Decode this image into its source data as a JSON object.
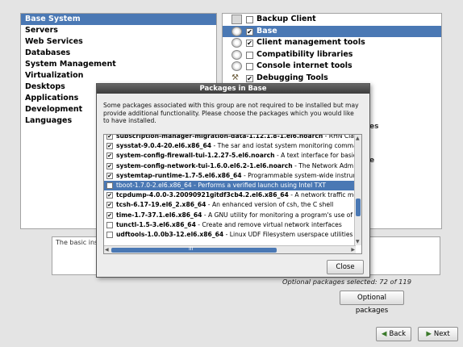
{
  "categories": [
    {
      "label": "Base System",
      "selected": true
    },
    {
      "label": "Servers",
      "selected": false
    },
    {
      "label": "Web Services",
      "selected": false
    },
    {
      "label": "Databases",
      "selected": false
    },
    {
      "label": "System Management",
      "selected": false
    },
    {
      "label": "Virtualization",
      "selected": false
    },
    {
      "label": "Desktops",
      "selected": false
    },
    {
      "label": "Applications",
      "selected": false
    },
    {
      "label": "Development",
      "selected": false
    },
    {
      "label": "Languages",
      "selected": false
    }
  ],
  "groups": [
    {
      "label": "Backup Client",
      "checked": false,
      "selected": false,
      "icon": "panel-icon"
    },
    {
      "label": "Base",
      "checked": true,
      "selected": true,
      "icon": "disk-icon"
    },
    {
      "label": "Client management tools",
      "checked": true,
      "selected": false,
      "icon": "disk-icon"
    },
    {
      "label": "Compatibility libraries",
      "checked": false,
      "selected": false,
      "icon": "disk-icon"
    },
    {
      "label": "Console internet tools",
      "checked": false,
      "selected": false,
      "icon": "disk-icon"
    },
    {
      "label": "Debugging Tools",
      "checked": true,
      "selected": false,
      "icon": "tools-icon"
    }
  ],
  "group_overflow_glyphs": [
    "es",
    "e"
  ],
  "description": "The basic inst",
  "optional_selected": "Optional packages selected: 72 of 119",
  "buttons": {
    "optional_packages": "Optional packages",
    "back": "Back",
    "next": "Next",
    "close": "Close"
  },
  "dialog": {
    "title": "Packages in Base",
    "intro": "Some packages associated with this group are not required to be installed but may provide additional functionality. Please choose the packages which you would like to have installed.",
    "packages": [
      {
        "name": "subscription-manager-migration-data-1.12.1.8-1.el6.noarch",
        "desc": " - RHN Cla",
        "checked": true,
        "selected": false
      },
      {
        "name": "sysstat-9.0.4-20.el6.x86_64",
        "desc": " - The sar and iostat system monitoring comman",
        "checked": true,
        "selected": false
      },
      {
        "name": "system-config-firewall-tui-1.2.27-5.el6.noarch",
        "desc": " - A text interface for basic",
        "checked": true,
        "selected": false
      },
      {
        "name": "system-config-network-tui-1.6.0.el6.2-1.el6.noarch",
        "desc": " - The Network Admin",
        "checked": true,
        "selected": false
      },
      {
        "name": "systemtap-runtime-1.7-5.el6.x86_64",
        "desc": " - Programmable system-wide instrum",
        "checked": true,
        "selected": false
      },
      {
        "name": "tboot-1.7.0-2.el6.x86_64",
        "desc": " - Performs a verified launch using Intel TXT",
        "checked": false,
        "selected": true
      },
      {
        "name": "tcpdump-4.0.0-3.20090921gitdf3cb4.2.el6.x86_64",
        "desc": " - A network traffic mon",
        "checked": true,
        "selected": false
      },
      {
        "name": "tcsh-6.17-19.el6_2.x86_64",
        "desc": " - An enhanced version of csh, the C shell",
        "checked": true,
        "selected": false
      },
      {
        "name": "time-1.7-37.1.el6.x86_64",
        "desc": " - A GNU utility for monitoring a program's use of sy",
        "checked": true,
        "selected": false
      },
      {
        "name": "tunctl-1.5-3.el6.x86_64",
        "desc": " - Create and remove virtual network interfaces",
        "checked": false,
        "selected": false
      },
      {
        "name": "udftools-1.0.0b3-12.el6.x86_64",
        "desc": " - Linux UDF Filesystem userspace utilities",
        "checked": false,
        "selected": false
      }
    ],
    "scroll_thumb_grip": "III"
  }
}
